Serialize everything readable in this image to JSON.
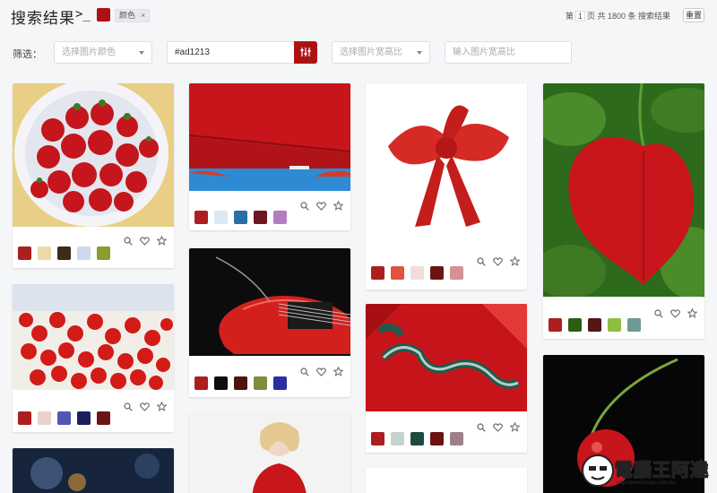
{
  "header": {
    "title": "搜索结果",
    "prompt_icon": ">_",
    "selected_color": "#ad1213",
    "tag_label": "颜色",
    "tag_close": "×",
    "page_prefix": "第",
    "page_num": "1",
    "page_unit": "页",
    "total_text": "共 1800 条 搜索结果",
    "reset_label": "重置"
  },
  "filters": {
    "label": "筛选：",
    "color_placeholder": "选择图片颜色",
    "hex_value": "#ad1213",
    "ratio_placeholder": "选择图片宽高比",
    "ratio_input_placeholder": "输入图片宽高比",
    "accent": "#ad1213"
  },
  "cards": [
    {
      "name": "strawberries",
      "swatches": [
        "#ad1f1f",
        "#ecd9a8",
        "#3b2c17",
        "#cdd9ef",
        "#8e9b31"
      ]
    },
    {
      "name": "umbrella-sea",
      "swatches": [
        "#b01c22",
        "#dce7f5",
        "#2b6ea6",
        "#6e1622",
        "#b57dc0"
      ]
    },
    {
      "name": "ribbon-bow",
      "swatches": [
        "#ad1f1f",
        "#e0533f",
        "#f2dcdc",
        "#6b1414",
        "#d79094"
      ]
    },
    {
      "name": "heart-leaf",
      "swatches": [
        "#ad1f1f",
        "#2e5d12",
        "#551616",
        "#8ebd3f",
        "#6c9a95"
      ]
    },
    {
      "name": "red-currants",
      "swatches": [
        "#ad1f1f",
        "#ead1cc",
        "#5257b3",
        "#1c1f5e",
        "#6c1414"
      ]
    },
    {
      "name": "guitar",
      "swatches": [
        "#ad1f1f",
        "#0d0d0d",
        "#4f1212",
        "#7e8c3b",
        "#2b2fa1"
      ]
    },
    {
      "name": "jersey",
      "swatches": [
        "#ad1f1f",
        "#c5d3cd",
        "#1e4a3e",
        "#6b1212",
        "#9f8088"
      ]
    },
    {
      "name": "cherry",
      "swatches": []
    },
    {
      "name": "bokeh",
      "swatches": []
    },
    {
      "name": "woman-red-dress",
      "swatches": []
    },
    {
      "name": "blank-card",
      "swatches": []
    }
  ],
  "icons": {
    "zoom": "magnifier-icon",
    "like": "heart-icon",
    "fav": "star-icon"
  },
  "watermark": {
    "text": "電腦王阿達",
    "url": "http://www.kocpc.com.tw"
  }
}
